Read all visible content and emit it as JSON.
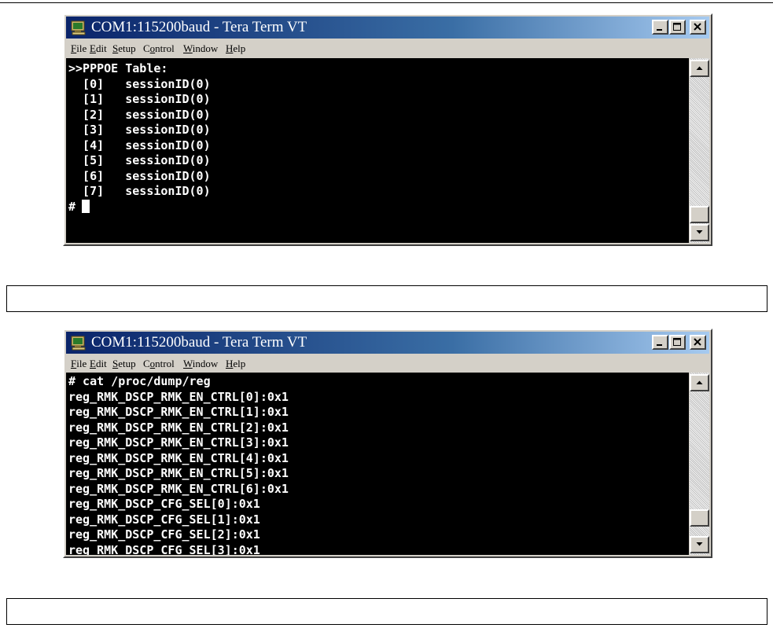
{
  "window1": {
    "title": "COM1:115200baud - Tera Term VT",
    "menu": [
      {
        "label": "File",
        "key": "F",
        "rest": "ile"
      },
      {
        "label": "Edit",
        "key": "E",
        "rest": "dit"
      },
      {
        "label": "Setup",
        "key": "S",
        "rest": "etup"
      },
      {
        "label": "Control",
        "pre": "C",
        "key": "o",
        "rest": "ntrol"
      },
      {
        "label": "Window",
        "key": "W",
        "rest": "indow"
      },
      {
        "label": "Help",
        "key": "H",
        "rest": "elp"
      }
    ],
    "lines": [
      "",
      ">>PPPOE Table:",
      "  [0]   sessionID(0)",
      "  [1]   sessionID(0)",
      "  [2]   sessionID(0)",
      "  [3]   sessionID(0)",
      "  [4]   sessionID(0)",
      "  [5]   sessionID(0)",
      "  [6]   sessionID(0)",
      "  [7]   sessionID(0)"
    ],
    "prompt": "#"
  },
  "window2": {
    "title": "COM1:115200baud - Tera Term VT",
    "menu": [
      {
        "label": "File",
        "key": "F",
        "rest": "ile"
      },
      {
        "label": "Edit",
        "key": "E",
        "rest": "dit"
      },
      {
        "label": "Setup",
        "key": "S",
        "rest": "etup"
      },
      {
        "label": "Control",
        "pre": "C",
        "key": "o",
        "rest": "ntrol"
      },
      {
        "label": "Window",
        "key": "W",
        "rest": "indow"
      },
      {
        "label": "Help",
        "key": "H",
        "rest": "elp"
      }
    ],
    "lines": [
      "# cat /proc/dump/reg",
      "reg_RMK_DSCP_RMK_EN_CTRL[0]:0x1",
      "reg_RMK_DSCP_RMK_EN_CTRL[1]:0x1",
      "reg_RMK_DSCP_RMK_EN_CTRL[2]:0x1",
      "reg_RMK_DSCP_RMK_EN_CTRL[3]:0x1",
      "reg_RMK_DSCP_RMK_EN_CTRL[4]:0x1",
      "reg_RMK_DSCP_RMK_EN_CTRL[5]:0x1",
      "reg_RMK_DSCP_RMK_EN_CTRL[6]:0x1",
      "reg_RMK_DSCP_CFG_SEL[0]:0x1",
      "reg_RMK_DSCP_CFG_SEL[1]:0x1",
      "reg_RMK_DSCP_CFG_SEL[2]:0x1",
      "reg_RMK_DSCP_CFG_SEL[3]:0x1"
    ]
  },
  "icons": {
    "app": "tera-term-icon",
    "minimize": "minimize-icon",
    "maximize": "maximize-icon",
    "close": "close-icon",
    "scroll_up": "arrow-up-icon",
    "scroll_down": "arrow-down-icon"
  },
  "colors": {
    "title_bar_start": "#0a246a",
    "title_bar_end": "#a6caf0",
    "terminal_bg": "#000000",
    "terminal_fg": "#ffffff",
    "chrome": "#d4d0c8"
  }
}
